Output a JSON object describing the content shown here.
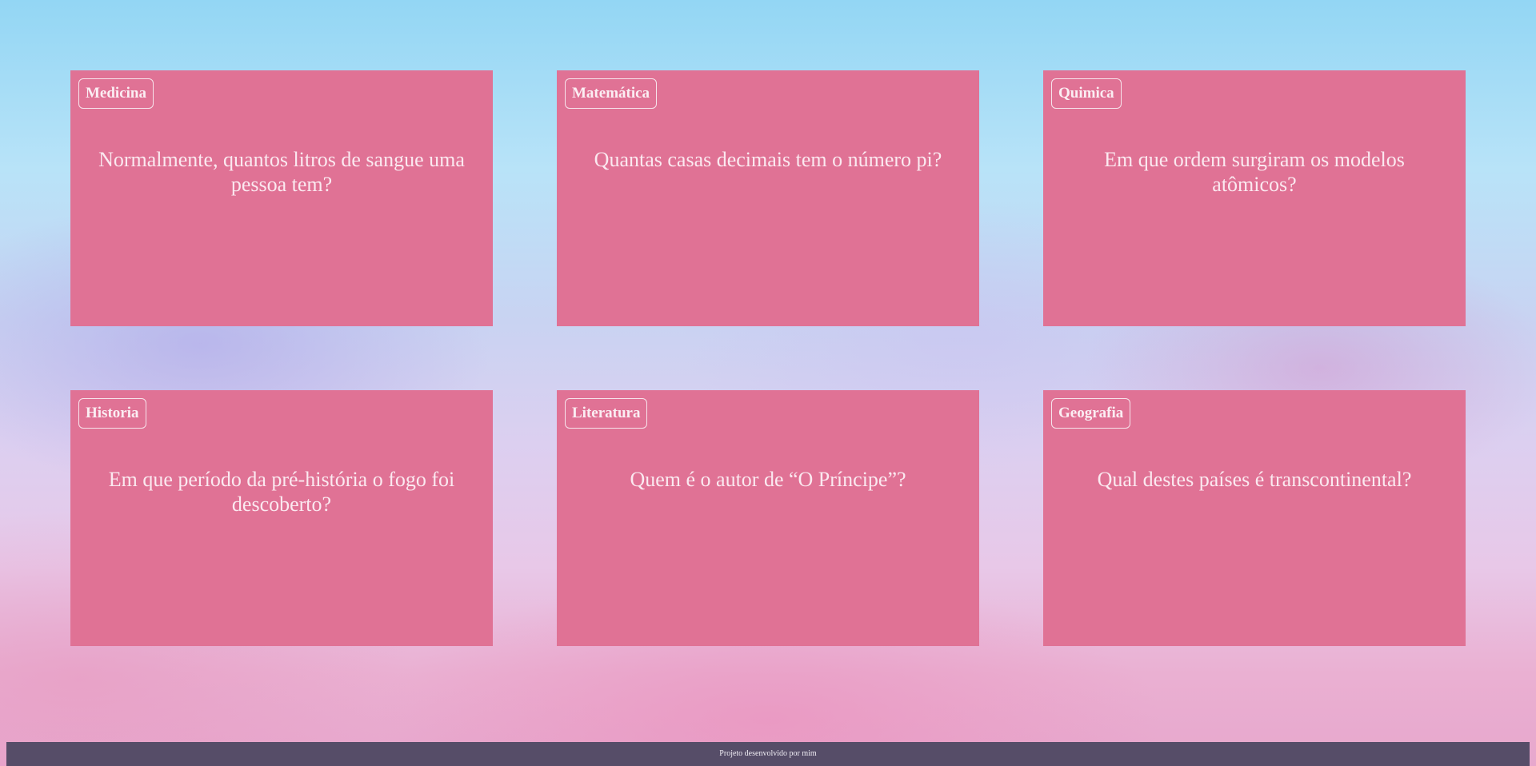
{
  "cards": [
    {
      "category": "Medicina",
      "question": "Normalmente, quantos litros de sangue uma pessoa tem?"
    },
    {
      "category": "Matemática",
      "question": "Quantas casas decimais tem o número pi?"
    },
    {
      "category": "Quimica",
      "question": "Em que ordem surgiram os modelos atômicos?"
    },
    {
      "category": "Historia",
      "question": "Em que período da pré-história o fogo foi descoberto?"
    },
    {
      "category": "Literatura",
      "question": "Quem é o autor de “O Príncipe”?"
    },
    {
      "category": "Geografia",
      "question": "Qual destes países é transcontinental?"
    }
  ],
  "footer": {
    "text": "Projeto desenvolvido por mim"
  },
  "colors": {
    "card": "#e07295",
    "footer": "#564d68"
  }
}
